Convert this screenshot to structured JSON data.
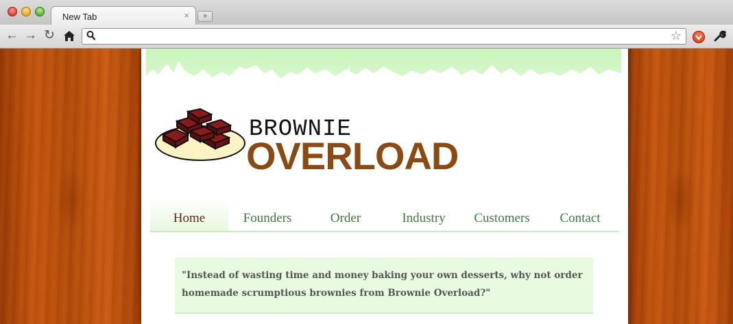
{
  "browser": {
    "tab_title": "New Tab",
    "tab_close_glyph": "×",
    "new_tab_glyph": "+",
    "address_value": "",
    "icons": [
      "back-icon",
      "forward-icon",
      "reload-icon",
      "home-icon",
      "search-icon",
      "bookmark-star-icon",
      "extension-icon",
      "wrench-icon"
    ]
  },
  "site": {
    "brand_line1": "BROWNIE",
    "brand_line2": "OVERLOAD",
    "nav": [
      {
        "label": "Home",
        "active": true
      },
      {
        "label": "Founders"
      },
      {
        "label": "Order"
      },
      {
        "label": "Industry"
      },
      {
        "label": "Customers"
      },
      {
        "label": "Contact"
      }
    ],
    "quote": "\"Instead of wasting time and money baking your own desserts, why not order homemade scrumptious brownies from Brownie Overload?\""
  },
  "colors": {
    "brand_brown": "#8a4a12",
    "nav_green": "#3d7a3a",
    "quote_bg": "#e8fadf",
    "wood": "#c4550f"
  }
}
